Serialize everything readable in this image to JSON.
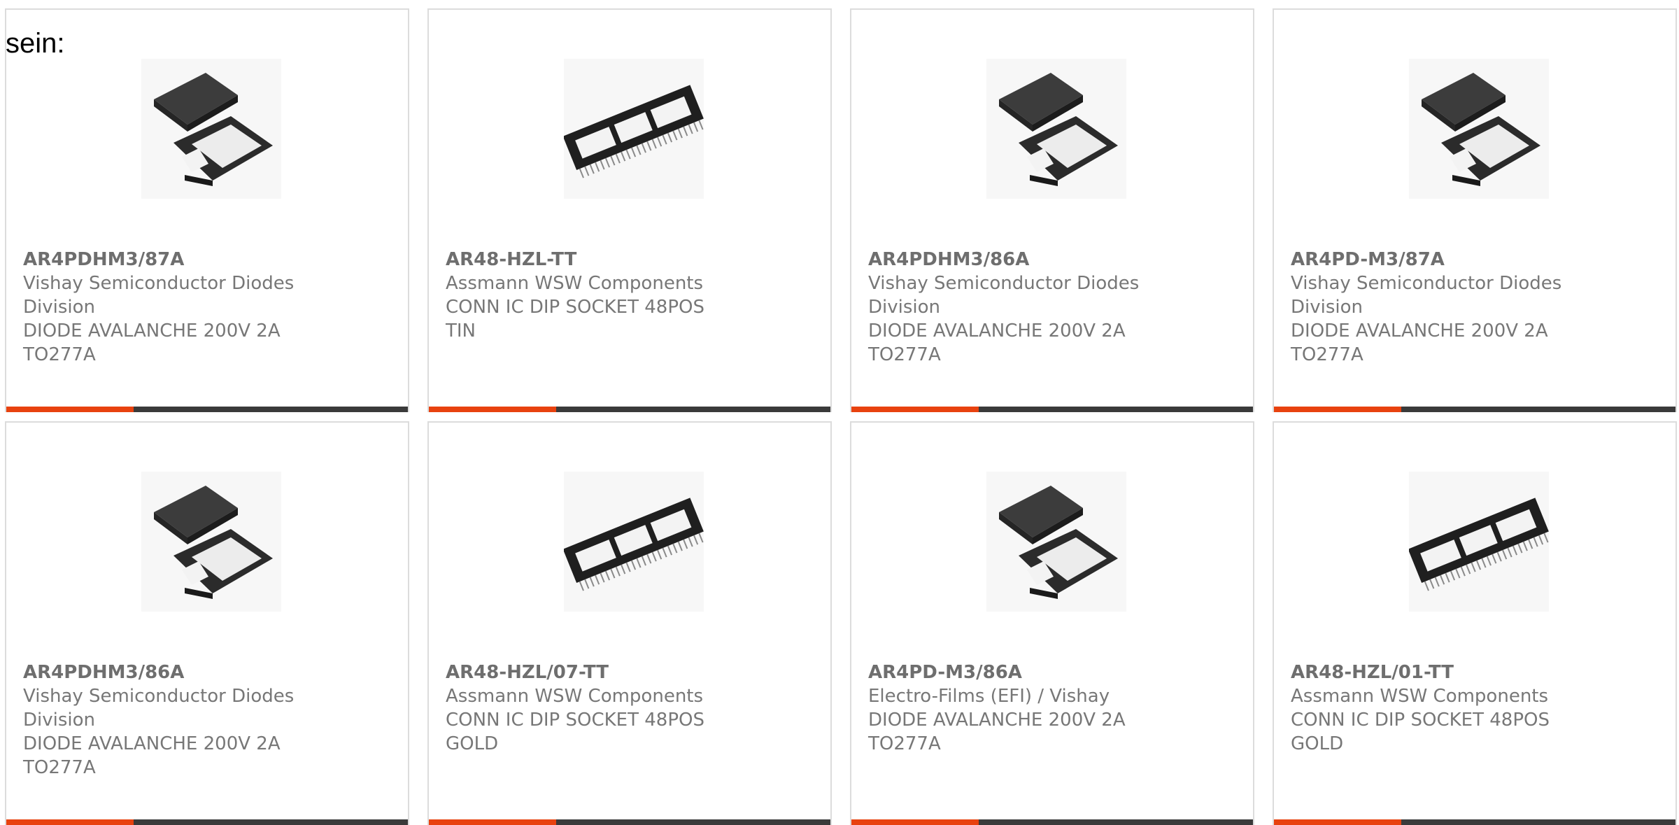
{
  "intro_text": "sein:",
  "accent_color": "#e8420f",
  "cards": [
    {
      "part_number": "AR4PDHM3/87A",
      "manufacturer": "Vishay Semiconductor Diodes Division",
      "description": "DIODE AVALANCHE 200V 2A TO277A",
      "image_icon": "diode-package-icon"
    },
    {
      "part_number": "AR48-HZL-TT",
      "manufacturer": "Assmann WSW Components",
      "description": "CONN IC DIP SOCKET 48POS TIN",
      "image_icon": "dip-socket-icon"
    },
    {
      "part_number": "AR4PDHM3/86A",
      "manufacturer": "Vishay Semiconductor Diodes Division",
      "description": "DIODE AVALANCHE 200V 2A TO277A",
      "image_icon": "diode-package-icon"
    },
    {
      "part_number": "AR4PD-M3/87A",
      "manufacturer": "Vishay Semiconductor Diodes Division",
      "description": "DIODE AVALANCHE 200V 2A TO277A",
      "image_icon": "diode-package-icon"
    },
    {
      "part_number": "AR4PDHM3/86A",
      "manufacturer": "Vishay Semiconductor Diodes Division",
      "description": "DIODE AVALANCHE 200V 2A TO277A",
      "image_icon": "diode-package-icon"
    },
    {
      "part_number": "AR48-HZL/07-TT",
      "manufacturer": "Assmann WSW Components",
      "description": "CONN IC DIP SOCKET 48POS GOLD",
      "image_icon": "dip-socket-icon"
    },
    {
      "part_number": "AR4PD-M3/86A",
      "manufacturer": "Electro-Films (EFI) / Vishay",
      "description": "DIODE AVALANCHE 200V 2A TO277A",
      "image_icon": "diode-package-icon"
    },
    {
      "part_number": "AR48-HZL/01-TT",
      "manufacturer": "Assmann WSW Components",
      "description": "CONN IC DIP SOCKET 48POS GOLD",
      "image_icon": "dip-socket-icon"
    }
  ]
}
